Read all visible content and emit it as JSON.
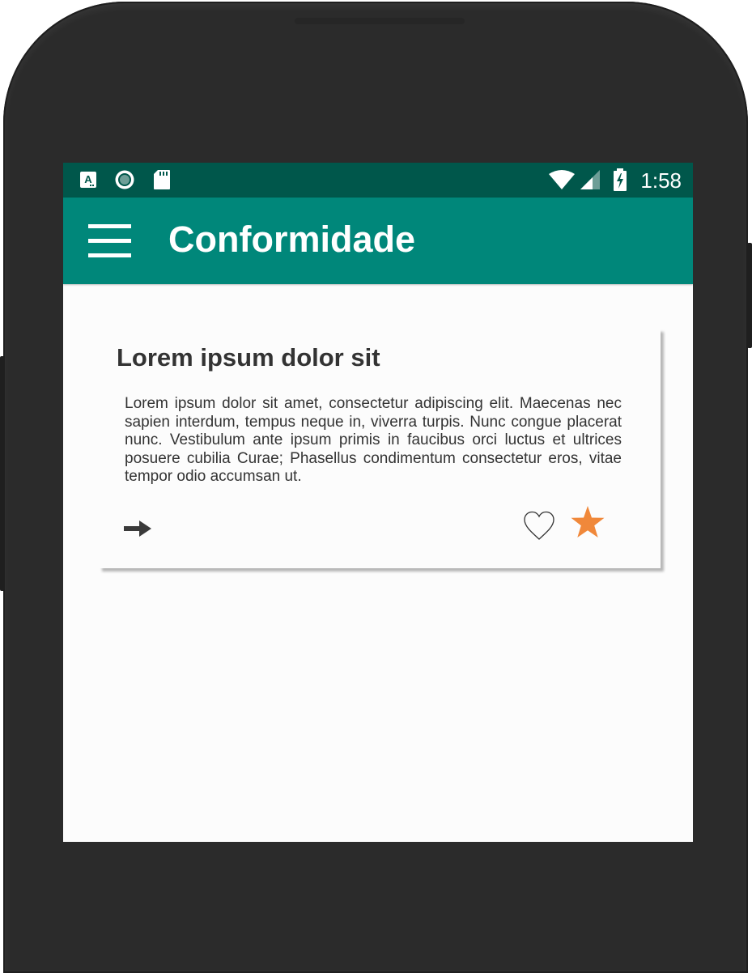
{
  "status_bar": {
    "time": "1:58",
    "icons": [
      "accessibility-a-icon",
      "sync-circle-icon",
      "sd-card-icon",
      "wifi-icon",
      "signal-icon",
      "battery-charging-icon"
    ]
  },
  "app_bar": {
    "title": "Conformidade",
    "menu_icon": "hamburger-menu-icon"
  },
  "card": {
    "title": "Lorem ipsum dolor sit",
    "body": "Lorem ipsum dolor sit amet, consectetur adipiscing elit. Maecenas nec sapien interdum, tempus neque in, viverra turpis. Nunc congue placerat nunc. Vestibulum ante ipsum primis in faucibus orci luctus et ultrices posuere cubilia Curae; Phasellus condimentum consectetur eros, vitae tempor odio accumsan ut.",
    "actions": {
      "open_icon": "arrow-right-icon",
      "favorite_icon": "heart-outline-icon",
      "rating_icon": "star-filled-icon"
    }
  },
  "colors": {
    "status_bar": "#00574b",
    "app_bar": "#00877a",
    "accent_star": "#f0883a",
    "device_frame": "#2b2b2b",
    "text_dark": "#333333"
  }
}
